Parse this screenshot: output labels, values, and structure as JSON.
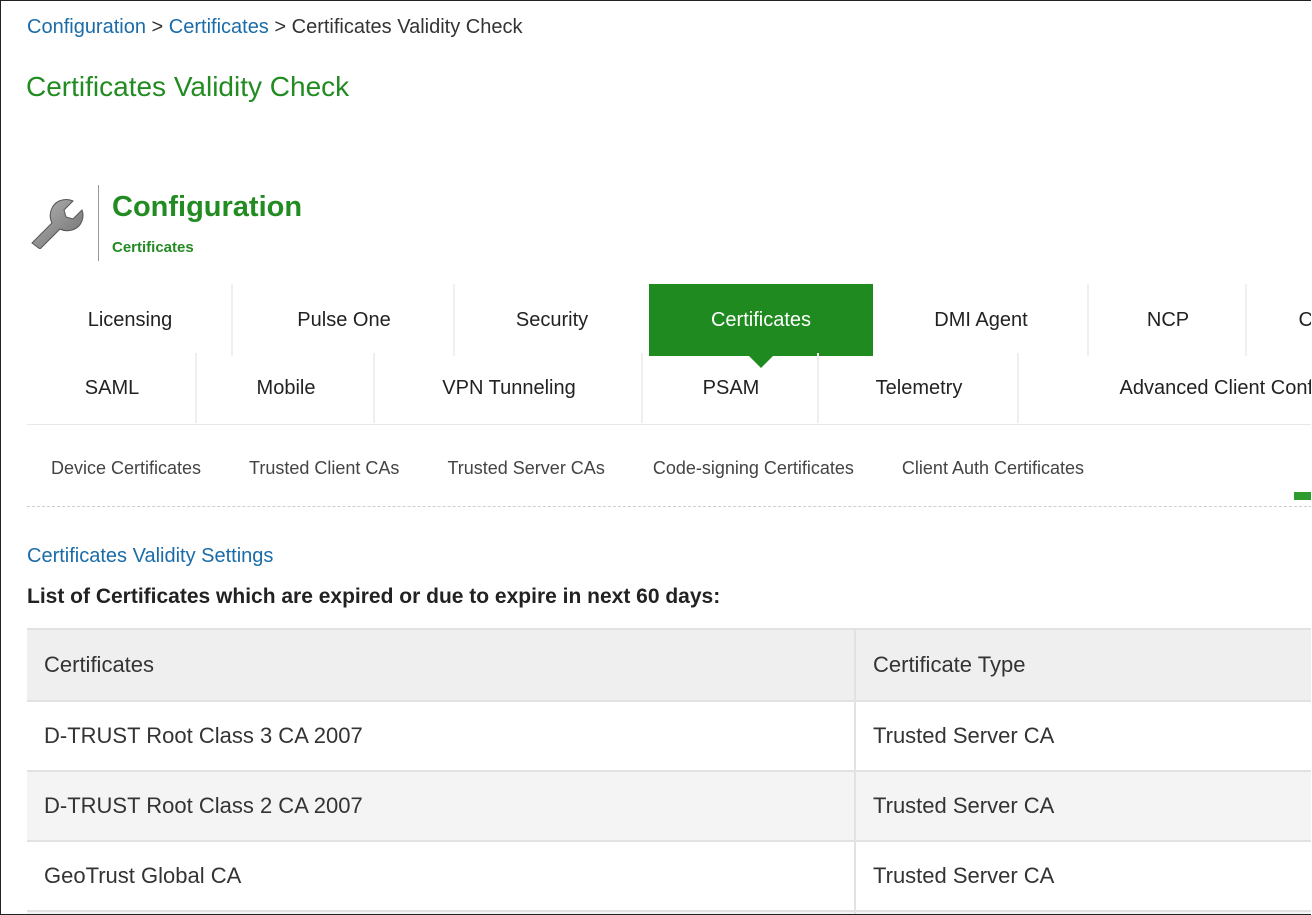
{
  "breadcrumb": {
    "items": [
      "Configuration",
      "Certificates"
    ],
    "separator": ">",
    "current": "Certificates Validity Check"
  },
  "page_title": "Certificates Validity Check",
  "section_header": {
    "icon": "wrench-icon",
    "title": "Configuration",
    "subtitle": "Certificates"
  },
  "tabs_row1": [
    {
      "label": "Licensing"
    },
    {
      "label": "Pulse One"
    },
    {
      "label": "Security"
    },
    {
      "label": "Certificates",
      "active": true
    },
    {
      "label": "DMI Agent"
    },
    {
      "label": "NCP"
    },
    {
      "label": "C"
    }
  ],
  "tabs_row2": [
    {
      "label": "SAML"
    },
    {
      "label": "Mobile"
    },
    {
      "label": "VPN Tunneling"
    },
    {
      "label": "PSAM"
    },
    {
      "label": "Telemetry"
    },
    {
      "label": "Advanced Client Conf"
    }
  ],
  "subtabs": [
    {
      "label": "Device Certificates"
    },
    {
      "label": "Trusted Client CAs"
    },
    {
      "label": "Trusted Server CAs"
    },
    {
      "label": "Code-signing Certificates"
    },
    {
      "label": "Client Auth Certificates"
    }
  ],
  "settings_link": "Certificates Validity Settings",
  "list_title": "List of Certificates which are expired or due to expire in next 60 days:",
  "table": {
    "headers": [
      "Certificates",
      "Certificate Type"
    ],
    "rows": [
      [
        "D-TRUST Root Class 3 CA 2007",
        "Trusted Server CA"
      ],
      [
        "D-TRUST Root Class 2 CA 2007",
        "Trusted Server CA"
      ],
      [
        "GeoTrust Global CA",
        "Trusted Server CA"
      ]
    ]
  },
  "colors": {
    "accent_green": "#1f8a1f",
    "title_green": "#228b22",
    "link_blue": "#1a6ca8"
  }
}
